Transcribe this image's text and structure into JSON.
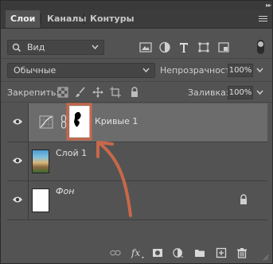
{
  "tabs": [
    {
      "label": "Слои",
      "active": true
    },
    {
      "label": "Каналы",
      "active": false
    },
    {
      "label": "Контуры",
      "active": false
    }
  ],
  "filter": {
    "icon": "search-icon",
    "label": "Вид",
    "kind_icons": [
      "image-filter-icon",
      "adjustment-filter-icon",
      "text-filter-icon",
      "shape-filter-icon",
      "smart-object-filter-icon"
    ]
  },
  "blend": {
    "mode": "Обычные",
    "opacity_label": "Непрозрачность:",
    "opacity_value": "100%"
  },
  "lock": {
    "label": "Закрепить:",
    "fill_label": "Заливка:",
    "fill_value": "100%",
    "icons": [
      "lock-transparent-icon",
      "lock-brush-icon",
      "lock-position-icon",
      "lock-artboard-icon",
      "lock-all-icon"
    ]
  },
  "layers": [
    {
      "name": "Кривые 1",
      "kind": "adjustment-curves",
      "selected": true,
      "visible": true
    },
    {
      "name": "Слой 1",
      "kind": "image",
      "selected": false,
      "visible": true
    },
    {
      "name": "Фон",
      "kind": "background",
      "italic": true,
      "selected": false,
      "visible": true,
      "locked": true
    }
  ],
  "bottom_icons": [
    "link-icon",
    "fx-icon",
    "mask-icon",
    "adjustment-icon",
    "folder-icon",
    "new-layer-icon",
    "trash-icon"
  ],
  "colors": {
    "panel": "#535353",
    "selected_row": "#6c6c6c",
    "annotation": "#c8684a"
  }
}
